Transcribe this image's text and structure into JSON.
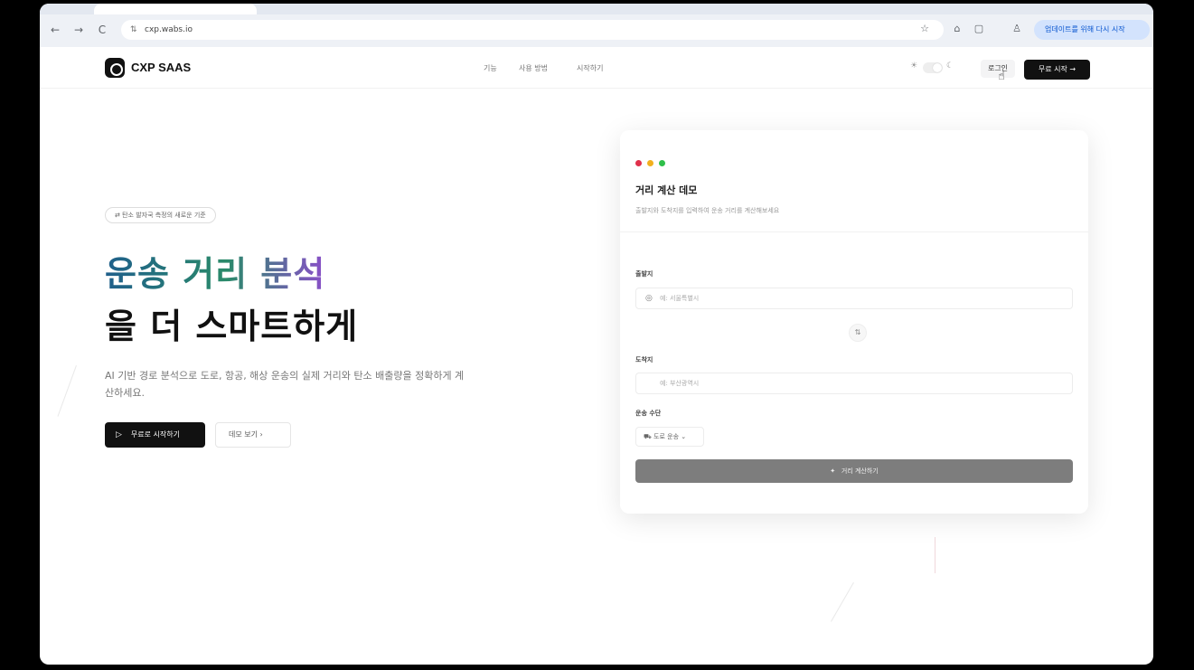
{
  "browser": {
    "url": "cxp.wabs.io",
    "update_button": "업데이트를 위해 다시 시작",
    "nav_back": "←",
    "nav_forward": "→",
    "reload": "C",
    "site_info_icon": "⇅",
    "star_icon": "☆",
    "icons": [
      "star-icon",
      "lock-icon",
      "extension-icon",
      "profile-icon"
    ]
  },
  "header": {
    "brand": "CXP SAAS",
    "nav": [
      "기능",
      "사용 방법",
      "시작하기"
    ],
    "theme_sun": "☀",
    "theme_moon": "☾",
    "login": "로그인",
    "cta": "무료 시작 →"
  },
  "hero": {
    "badge": "⇄ 탄소 발자국 측정의 새로운 기준",
    "title_line1": "운송 거리 분석",
    "title_line2": "을 더 스마트하게",
    "description": "AI 기반 경로 분석으로 도로, 항공, 해상 운송의 실제 거리와 탄소 배출량을 정확하게 계산하세요.",
    "primary_button": "무료로 시작하기",
    "primary_icon": "▷",
    "secondary_button": "데모 보기  ›"
  },
  "demo": {
    "dot_colors": [
      "#e0304b",
      "#f2b01e",
      "#2fbf4a"
    ],
    "title": "거리 계산 데모",
    "subtitle": "출발지와 도착지를 입력하여 운송 거리를 계산해보세요",
    "origin_label": "출발지",
    "origin_placeholder": "예: 서울특별시",
    "destination_label": "도착지",
    "destination_placeholder": "예: 부산광역시",
    "swap_icon": "⇅",
    "transport_label": "운송 수단",
    "transport_value": "도로 운송",
    "calculate_button": "거리 계산하기",
    "calculate_icon": "✦"
  }
}
